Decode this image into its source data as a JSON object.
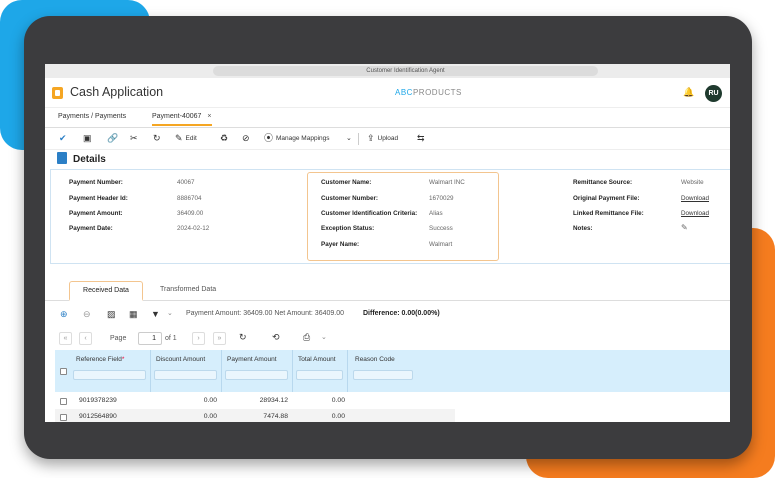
{
  "browser": {
    "url_text": "Customer Identification Agent"
  },
  "app": {
    "title": "Cash Application",
    "brand_prefix": "ABC",
    "brand_suffix": "PRODUCTS",
    "user_initials": "RU"
  },
  "tabs": [
    {
      "label": "Payments / Payments"
    },
    {
      "label": "Payment-40067",
      "close": "×"
    }
  ],
  "toolbar": {
    "edit_label": "Edit",
    "manage_mappings_label": "Manage Mappings",
    "upload_label": "Upload"
  },
  "details": {
    "title": "Details",
    "left": [
      {
        "k": "Payment Number:",
        "v": "40067"
      },
      {
        "k": "Payment Header Id:",
        "v": "8886704"
      },
      {
        "k": "Payment Amount:",
        "v": "36409.00"
      },
      {
        "k": "Payment Date:",
        "v": "2024-02-12"
      }
    ],
    "customer": [
      {
        "k": "Customer Name:",
        "v": "Walmart INC"
      },
      {
        "k": "Customer Number:",
        "v": "1670029"
      },
      {
        "k": "Customer Identification Criteria:",
        "v": "Alias"
      },
      {
        "k": "Exception Status:",
        "v": "Success"
      },
      {
        "k": "Payer Name:",
        "v": "Walmart"
      }
    ],
    "right": [
      {
        "k": "Remittance Source:",
        "v": "Website"
      },
      {
        "k": "Original Payment File:",
        "v": "Download"
      },
      {
        "k": "Linked Remittance File:",
        "v": "Download"
      },
      {
        "k": "Notes:",
        "v": ""
      }
    ]
  },
  "subtabs": {
    "received": "Received Data",
    "transformed": "Transformed Data"
  },
  "summary": {
    "text": "Payment Amount: 36409.00  Net Amount: 36409.00",
    "difference": "Difference: 0.00(0.00%)"
  },
  "pager": {
    "page_label": "Page",
    "page_value": "1",
    "of_label": "of 1"
  },
  "grid": {
    "headers": {
      "ref": "Reference Field",
      "req": "*",
      "discount": "Discount Amount",
      "payment": "Payment Amount",
      "total": "Total Amount",
      "reason": "Reason Code"
    },
    "rows": [
      {
        "ref": "9019378239",
        "discount": "0.00",
        "payment": "28934.12",
        "total": "0.00"
      },
      {
        "ref": "9012564890",
        "discount": "0.00",
        "payment": "7474.88",
        "total": "0.00"
      }
    ]
  },
  "colors": {
    "accent_orange": "#f57c1f",
    "accent_blue": "#1ea7e8",
    "grid_header": "#d6eefc"
  }
}
